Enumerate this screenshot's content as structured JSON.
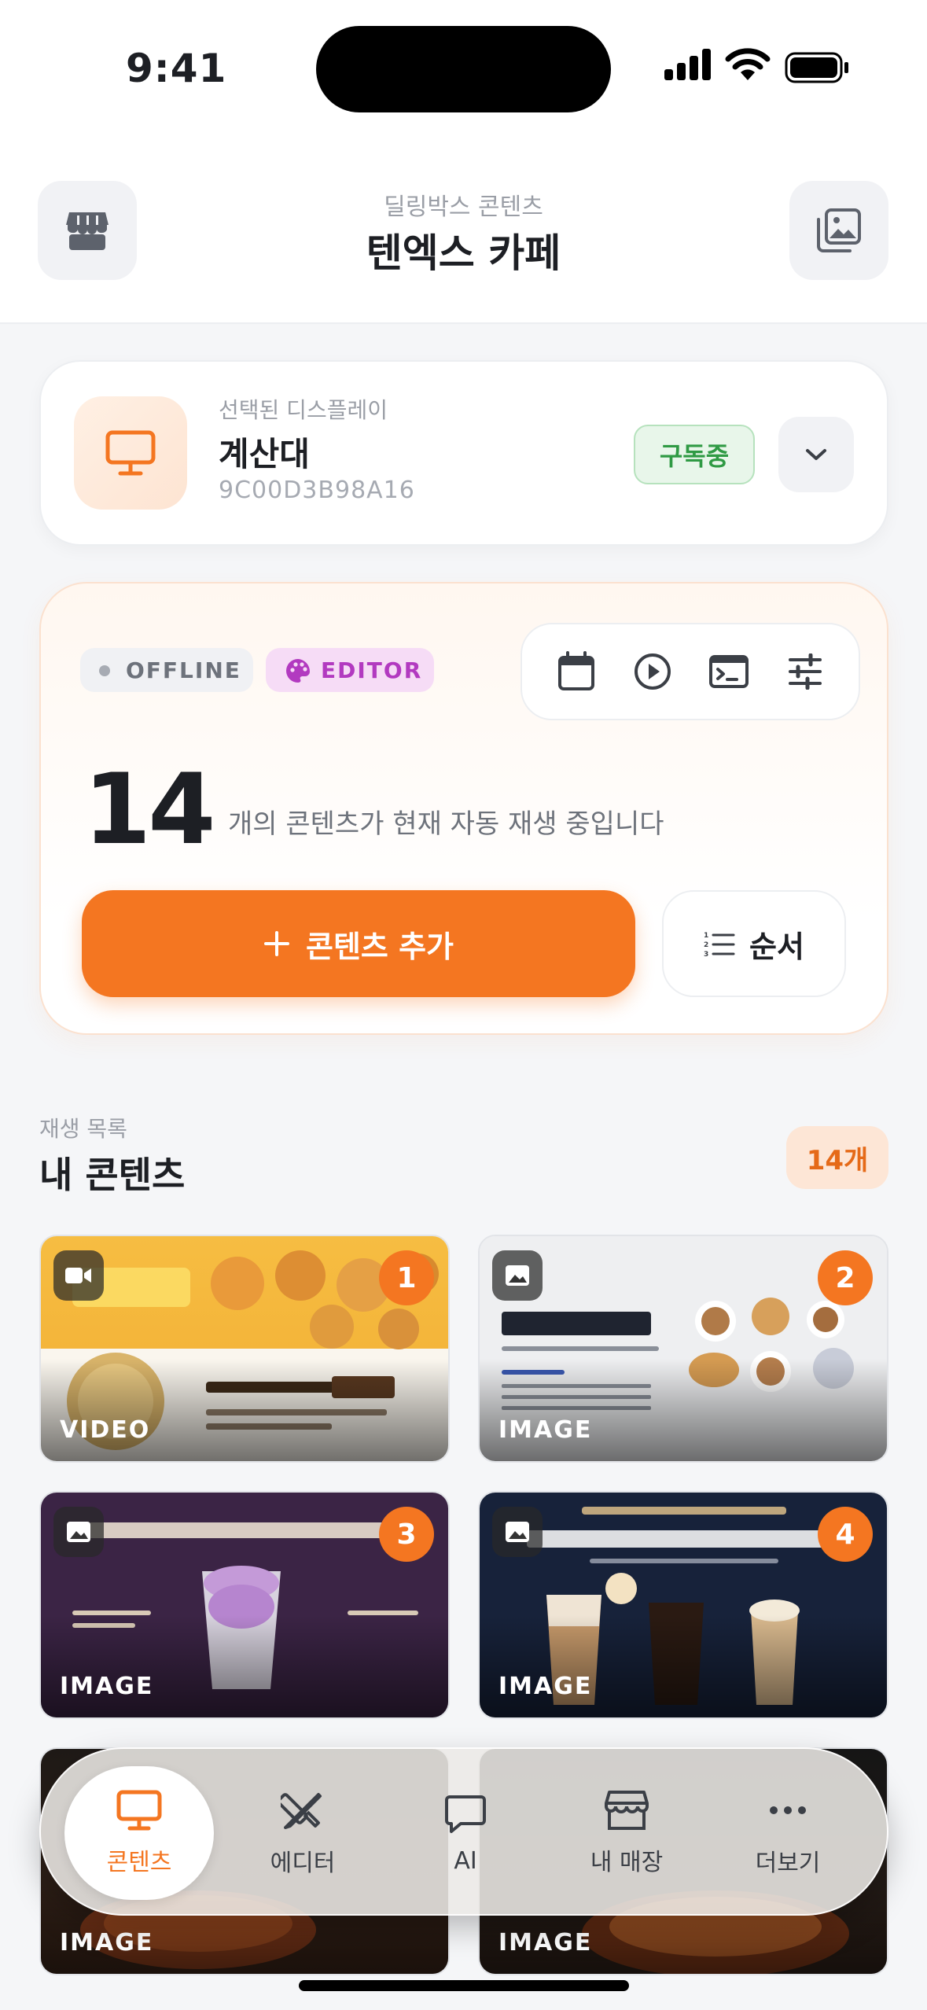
{
  "status_bar": {
    "time": "9:41"
  },
  "header": {
    "subtitle": "딜링박스 콘텐츠",
    "title": "텐엑스 카페"
  },
  "display": {
    "label": "선택된 디스플레이",
    "name": "계산대",
    "id": "9C00D3B98A16",
    "subscription": "구독중"
  },
  "status": {
    "connection": "OFFLINE",
    "mode": "EDITOR",
    "count": "14",
    "count_text": "개의 콘텐츠가 현재 자동 재생 중입니다",
    "add_label": "콘텐츠 추가",
    "order_label": "순서"
  },
  "section": {
    "subtitle": "재생 목록",
    "title": "내 콘텐츠",
    "count_badge": "14개"
  },
  "contents": [
    {
      "num": "1",
      "type": "VIDEO",
      "icon": "video-icon"
    },
    {
      "num": "2",
      "type": "IMAGE",
      "icon": "image-icon"
    },
    {
      "num": "3",
      "type": "IMAGE",
      "icon": "image-icon"
    },
    {
      "num": "4",
      "type": "IMAGE",
      "icon": "image-icon"
    },
    {
      "num": "",
      "type": "IMAGE",
      "icon": "image-icon"
    },
    {
      "num": "",
      "type": "IMAGE",
      "icon": "image-icon"
    }
  ],
  "tabs": [
    {
      "label": "콘텐츠",
      "icon": "monitor-icon",
      "active": true
    },
    {
      "label": "에디터",
      "icon": "edit-tools-icon",
      "active": false
    },
    {
      "label": "AI",
      "icon": "chat-bubble-icon",
      "active": false
    },
    {
      "label": "내 매장",
      "icon": "store-icon",
      "active": false
    },
    {
      "label": "더보기",
      "icon": "more-icon",
      "active": false
    }
  ],
  "colors": {
    "accent": "#f47621",
    "subscribed": "#2f9a44",
    "editor": "#b23ac0"
  }
}
